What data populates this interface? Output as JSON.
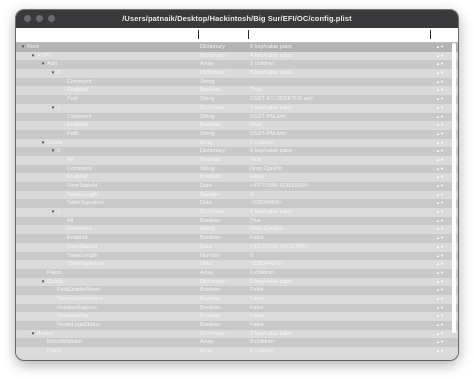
{
  "window": {
    "title": "/Users/patnaik/Desktop/Hackintosh/Big Sur/EFI/OC/config.plist"
  },
  "columns": {
    "key": "Key",
    "type": "Type",
    "value": "Value"
  },
  "rows": [
    {
      "key": "Root",
      "type": "Dictionary",
      "value": "8 key/value pairs",
      "level": 0,
      "disc": "open"
    },
    {
      "key": "ACPI",
      "type": "Dictionary",
      "value": "4 key/value pairs",
      "level": 1,
      "disc": "open"
    },
    {
      "key": "Add",
      "type": "Array",
      "value": "2 children",
      "level": 2,
      "disc": "open"
    },
    {
      "key": "0",
      "type": "Dictionary",
      "value": "3 key/value pairs",
      "level": 3,
      "disc": "open"
    },
    {
      "key": "Comment",
      "type": "String",
      "value": "",
      "level": 4
    },
    {
      "key": "Enabled",
      "type": "Boolean",
      "value": "True",
      "level": 4
    },
    {
      "key": "Path",
      "type": "String",
      "value": "SSDT-EC-DESKTOP.aml",
      "level": 4
    },
    {
      "key": "1",
      "type": "Dictionary",
      "value": "3 key/value pairs",
      "level": 3,
      "disc": "open"
    },
    {
      "key": "Comment",
      "type": "String",
      "value": "SSDT-PM.aml",
      "level": 4
    },
    {
      "key": "Enabled",
      "type": "Boolean",
      "value": "True",
      "level": 4
    },
    {
      "key": "Path",
      "type": "String",
      "value": "SSDT-PM.aml",
      "level": 4
    },
    {
      "key": "Delete",
      "type": "Array",
      "value": "2 children",
      "level": 2,
      "disc": "open"
    },
    {
      "key": "0",
      "type": "Dictionary",
      "value": "6 key/value pairs",
      "level": 3,
      "disc": "open"
    },
    {
      "key": "All",
      "type": "Boolean",
      "value": "True",
      "level": 4
    },
    {
      "key": "Comment",
      "type": "String",
      "value": "Drop CpuPm",
      "level": 4
    },
    {
      "key": "Enabled",
      "type": "Boolean",
      "value": "False",
      "level": 4
    },
    {
      "key": "OemTableId",
      "type": "Data",
      "value": "<43707550 6D000000>",
      "level": 4
    },
    {
      "key": "TableLength",
      "type": "Number",
      "value": "0",
      "level": 4
    },
    {
      "key": "TableSignature",
      "type": "Data",
      "value": "<53534454>",
      "level": 4
    },
    {
      "key": "1",
      "type": "Dictionary",
      "value": "6 key/value pairs",
      "level": 3,
      "disc": "open"
    },
    {
      "key": "All",
      "type": "Boolean",
      "value": "True",
      "level": 4
    },
    {
      "key": "Comment",
      "type": "String",
      "value": "Drop Cpu0Ist",
      "level": 4
    },
    {
      "key": "Enabled",
      "type": "Boolean",
      "value": "False",
      "level": 4
    },
    {
      "key": "OemTableId",
      "type": "Data",
      "value": "<43707530 49737400>",
      "level": 4
    },
    {
      "key": "TableLength",
      "type": "Number",
      "value": "0",
      "level": 4
    },
    {
      "key": "TableSignature",
      "type": "Data",
      "value": "<53534454>",
      "level": 4
    },
    {
      "key": "Patch",
      "type": "Array",
      "value": "0 children",
      "level": 2
    },
    {
      "key": "Quirks",
      "type": "Dictionary",
      "value": "5 key/value pairs",
      "level": 2,
      "disc": "open"
    },
    {
      "key": "FadtEnableReset",
      "type": "Boolean",
      "value": "False",
      "level": 3
    },
    {
      "key": "NormalizeHeaders",
      "type": "Boolean",
      "value": "False",
      "level": 3
    },
    {
      "key": "RebaseRegions",
      "type": "Boolean",
      "value": "False",
      "level": 3
    },
    {
      "key": "ResetHwSig",
      "type": "Boolean",
      "value": "False",
      "level": 3
    },
    {
      "key": "ResetLogoStatus",
      "type": "Boolean",
      "value": "False",
      "level": 3
    },
    {
      "key": "Booter",
      "type": "Dictionary",
      "value": "3 key/value pairs",
      "level": 1,
      "disc": "open"
    },
    {
      "key": "MmioWhitelist",
      "type": "Array",
      "value": "0 children",
      "level": 2
    },
    {
      "key": "Patch",
      "type": "Array",
      "value": "0 children",
      "level": 2
    }
  ]
}
